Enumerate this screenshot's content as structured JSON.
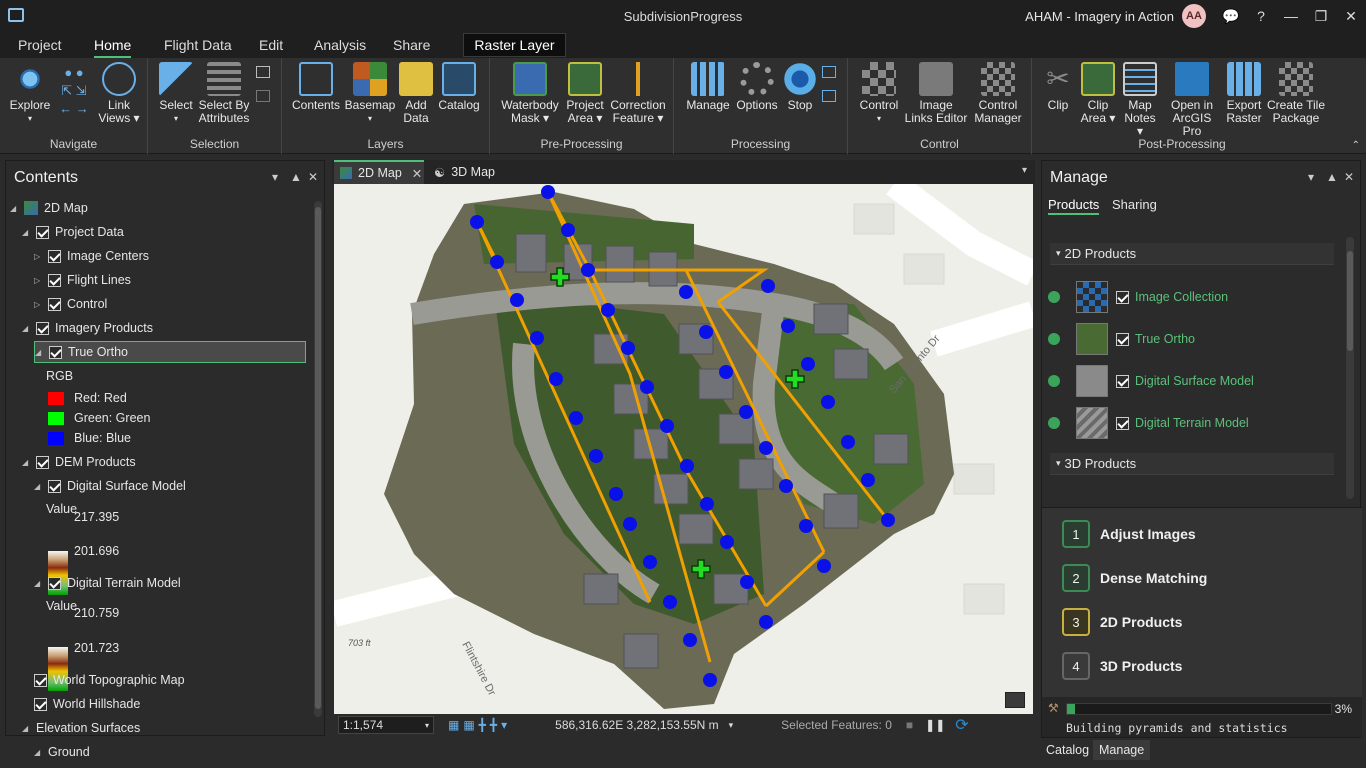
{
  "titlebar": {
    "title": "SubdivisionProgress",
    "project_name": "AHAM - Imagery in Action",
    "avatar_initials": "AA",
    "help": "?"
  },
  "menu_tabs": [
    "Project",
    "Home",
    "Flight Data",
    "Edit",
    "Analysis",
    "Share"
  ],
  "active_tab": "Home",
  "contextual_tab": "Raster Layer",
  "ribbon": {
    "groups": [
      {
        "name": "Navigate",
        "buttons": [
          "Explore",
          "Link Views"
        ]
      },
      {
        "name": "Selection",
        "buttons": [
          "Select",
          "Select By Attributes"
        ]
      },
      {
        "name": "Layers",
        "buttons": [
          "Contents",
          "Basemap",
          "Add Data",
          "Catalog"
        ]
      },
      {
        "name": "Pre-Processing",
        "buttons": [
          "Waterbody Mask",
          "Project Area",
          "Correction Feature"
        ]
      },
      {
        "name": "Processing",
        "buttons": [
          "Manage",
          "Options",
          "Stop"
        ]
      },
      {
        "name": "Control",
        "buttons": [
          "Control",
          "Image Links Editor",
          "Control Manager"
        ]
      },
      {
        "name": "Post-Processing",
        "buttons": [
          "Clip",
          "Clip Area",
          "Map Notes",
          "Open in ArcGIS Pro",
          "Export Raster",
          "Create Tile Package"
        ]
      }
    ],
    "labels": {
      "explore": "Explore",
      "link1": "Link",
      "link2": "Views",
      "select": "Select",
      "sba1": "Select By",
      "sba2": "Attributes",
      "contents": "Contents",
      "basemap": "Basemap",
      "add1": "Add",
      "add2": "Data",
      "catalog": "Catalog",
      "wb1": "Waterbody",
      "wb2": "Mask",
      "pa1": "Project",
      "pa2": "Area",
      "cf1": "Correction",
      "cf2": "Feature",
      "manage": "Manage",
      "options": "Options",
      "stop": "Stop",
      "control": "Control",
      "ile1": "Image",
      "ile2": "Links Editor",
      "cm1": "Control",
      "cm2": "Manager",
      "clip": "Clip",
      "ca1": "Clip",
      "ca2": "Area",
      "mn1": "Map",
      "mn2": "Notes",
      "oap1": "Open in",
      "oap2": "ArcGIS Pro",
      "er1": "Export",
      "er2": "Raster",
      "ctp1": "Create Tile",
      "ctp2": "Package",
      "g_navigate": "Navigate",
      "g_selection": "Selection",
      "g_layers": "Layers",
      "g_pre": "Pre-Processing",
      "g_processing": "Processing",
      "g_control": "Control",
      "g_post": "Post-Processing"
    }
  },
  "contents": {
    "title": "Contents",
    "tree": {
      "map2d": "2D Map",
      "project_data": "Project Data",
      "image_centers": "Image Centers",
      "flight_lines": "Flight Lines",
      "control": "Control",
      "imagery_products": "Imagery Products",
      "true_ortho": "True Ortho",
      "rgb": "RGB",
      "red": "Red:   Red",
      "green": "Green:  Green",
      "blue": "Blue:  Blue",
      "dem_products": "DEM Products",
      "dsm": "Digital Surface Model",
      "dsm_value": "Value",
      "dsm_max": "217.395",
      "dsm_min": "201.696",
      "dtm": "Digital Terrain Model",
      "dtm_value": "Value",
      "dtm_max": "210.759",
      "dtm_min": "201.723",
      "topo": "World Topographic Map",
      "hillshade": "World Hillshade",
      "elev": "Elevation Surfaces",
      "ground": "Ground"
    }
  },
  "map": {
    "tab_2d": "2D Map",
    "tab_3d": "3D Map",
    "scale": "1:1,574",
    "coords": "586,316.62E 3,282,153.55N m",
    "selected_features": "Selected Features: 0",
    "street1": "Flintshire Dr",
    "street2": "San Jacinto Dr",
    "elevation_label": "703 ft"
  },
  "manage": {
    "title": "Manage",
    "tabs": [
      "Products",
      "Sharing"
    ],
    "section_2d": "2D Products",
    "section_3d": "3D Products",
    "products": [
      "Image Collection",
      "True Ortho",
      "Digital Surface Model",
      "Digital Terrain Model"
    ],
    "steps": [
      {
        "num": "1",
        "label": "Adjust Images"
      },
      {
        "num": "2",
        "label": "Dense Matching"
      },
      {
        "num": "3",
        "label": "2D Products"
      },
      {
        "num": "4",
        "label": "3D Products"
      }
    ],
    "progress_percent": 3,
    "progress_label": "3%",
    "progress_status": "Building pyramids and statistics"
  },
  "bottom_tabs": [
    "Catalog",
    "Manage"
  ],
  "colors": {
    "accent": "#4ec07a",
    "flight_line": "#f0a000",
    "image_center": "#0000ff",
    "control_point": "#22dd22"
  }
}
